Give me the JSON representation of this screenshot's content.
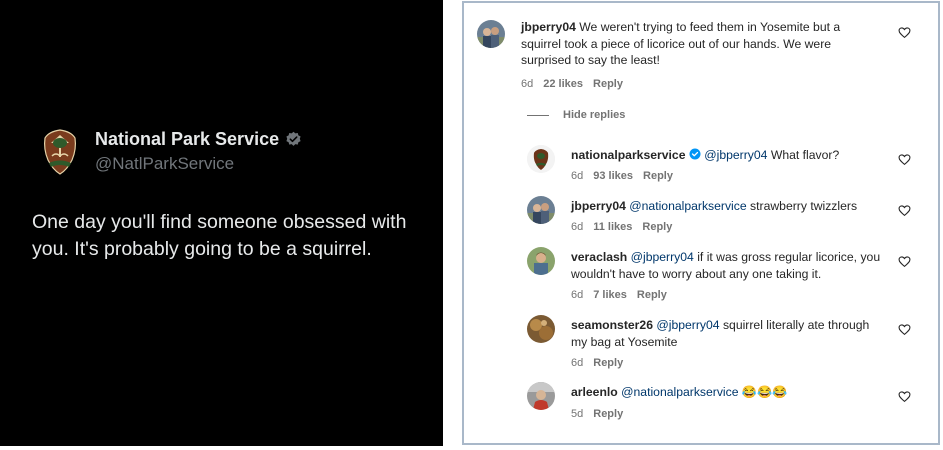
{
  "tweet": {
    "name": "National Park Service",
    "handle": "@NatlParkService",
    "text": "One day you'll find someone obsessed with you. It's probably going to be a squirrel."
  },
  "comments": {
    "hide_replies_label": "Hide replies",
    "items": [
      {
        "username": "jbperry04",
        "mention": "",
        "text": "We weren't trying to feed them in Yosemite but a squirrel took a piece of licorice out of our hands. We were surprised to say the least!",
        "age": "6d",
        "likes": "22 likes",
        "reply": "Reply"
      },
      {
        "username": "nationalparkservice",
        "mention": "@jbperry04",
        "text": "What flavor?",
        "age": "6d",
        "likes": "93 likes",
        "reply": "Reply"
      },
      {
        "username": "jbperry04",
        "mention": "@nationalparkservice",
        "text": "strawberry twizzlers",
        "age": "6d",
        "likes": "11 likes",
        "reply": "Reply"
      },
      {
        "username": "veraclash",
        "mention": "@jbperry04",
        "text": "if it was gross regular licorice, you wouldn't have to worry about any one taking it.",
        "age": "6d",
        "likes": "7 likes",
        "reply": "Reply"
      },
      {
        "username": "seamonster26",
        "mention": "@jbperry04",
        "text": "squirrel literally ate through my bag at Yosemite",
        "age": "6d",
        "likes": "",
        "reply": "Reply"
      },
      {
        "username": "arleenlo",
        "mention": "@nationalparkservice",
        "text": "😂😂😂",
        "age": "5d",
        "likes": "",
        "reply": "Reply"
      }
    ]
  },
  "colors": {
    "tweet_bg": "#000000",
    "verified_blue": "#1d9bf0",
    "mention_blue": "#00376b",
    "ig_verified": "#0095f6"
  },
  "icons": {
    "verified": "verified-badge-icon",
    "like": "heart-icon",
    "logo": "nps-arrowhead-logo"
  }
}
